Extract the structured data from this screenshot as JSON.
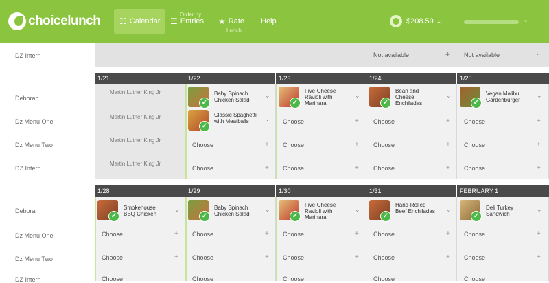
{
  "app": {
    "logo": "choicelunch",
    "nav": {
      "calendar": "Calendar",
      "entries_top": "Order by",
      "entries": "Entries",
      "rate_top": "Rate",
      "rate": "Lunch",
      "help": "Help"
    },
    "balance": "$208.59",
    "accent_color": "#8bc53f"
  },
  "filter_row": {
    "label": "DZ Intern",
    "select_1": "Not available",
    "select_2": "Not available"
  },
  "rows": {
    "deborah": "Deborah",
    "menu_one": "Dz Menu One",
    "menu_two": "Dz Menu Two",
    "intern": "DZ Intern"
  },
  "common": {
    "choose": "Choose"
  },
  "week1": {
    "days": [
      "1/21",
      "1/22",
      "1/23",
      "1/24",
      "1/25"
    ],
    "holiday": "Martin Luther King Jr",
    "meals": {
      "d2_deborah": "Baby Spinach Chicken Salad",
      "d2_menu_one": "Classic Spaghetti with Meatballs",
      "d3_deborah": "Five-Cheese Ravioli with Marinara",
      "d4_deborah": "Bean and Cheese Enchiladas",
      "d5_deborah": "Vegan Malibu Gardenburger"
    }
  },
  "week2": {
    "days": [
      "1/28",
      "1/29",
      "1/30",
      "1/31",
      "FEBRUARY 1"
    ],
    "meals": {
      "d1_deborah": "Smokehouse BBQ Chicken",
      "d2_deborah": "Baby Spinach Chicken Salad",
      "d3_deborah": "Five-Cheese Ravioli with Marinara",
      "d4_deborah": "Hand-Rolled Beef Enchiladas",
      "d5_deborah": "Deli Turkey Sandwich"
    }
  }
}
